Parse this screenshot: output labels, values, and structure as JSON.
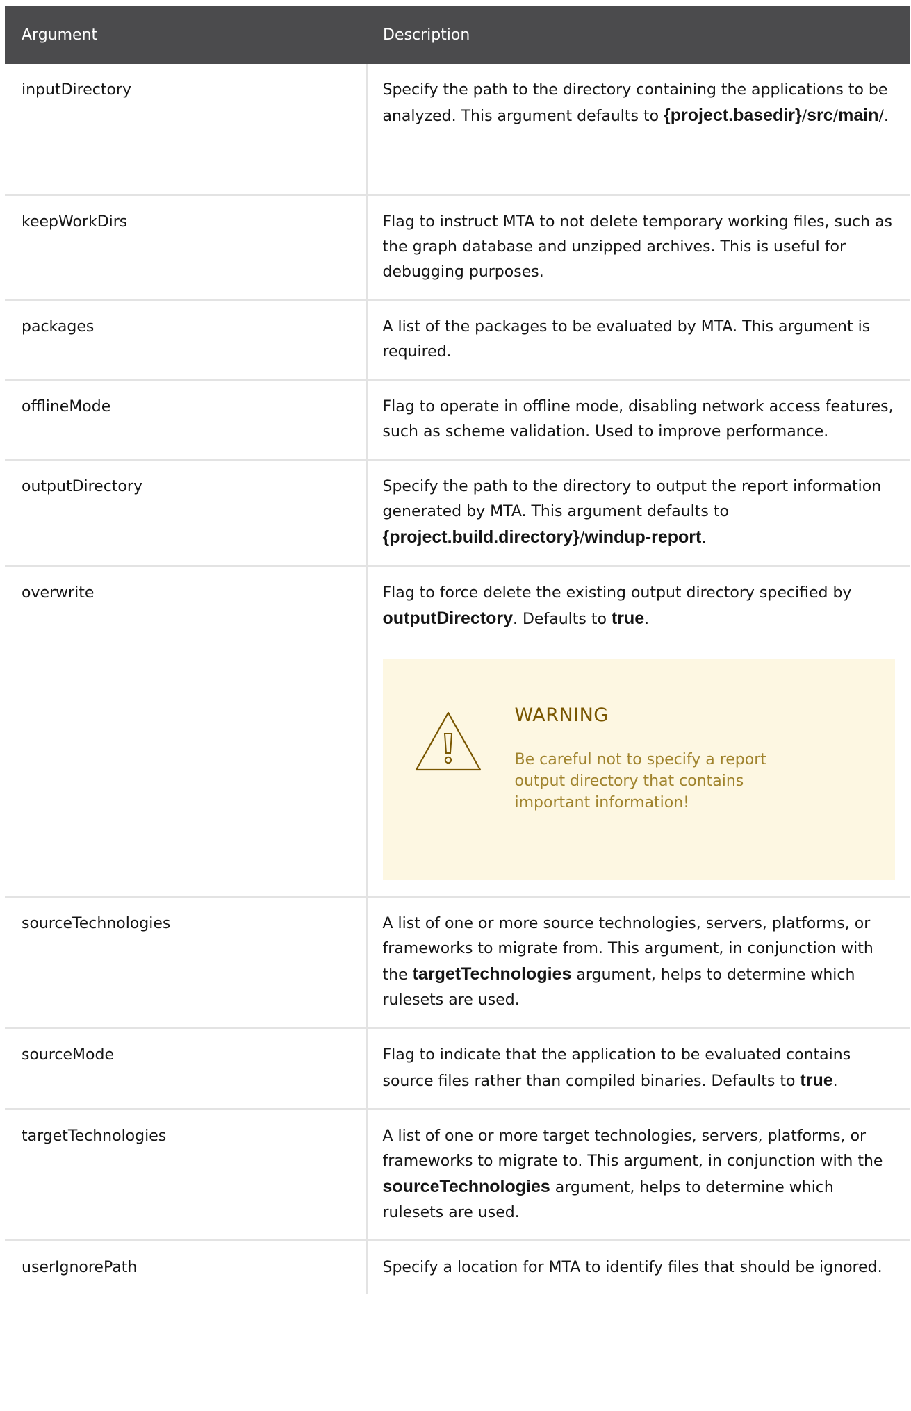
{
  "columns": {
    "argument": "Argument",
    "description": "Description"
  },
  "rows": [
    {
      "arg": "inputDirectory",
      "desc": [
        "Specify the path to the directory containing the applications to be analyzed. This argument defaults to ",
        "{project.basedir}",
        "/",
        "src",
        "/",
        "main",
        "/."
      ]
    },
    {
      "arg": "keepWorkDirs",
      "desc": [
        "Flag to instruct MTA to not delete temporary working files, such as the graph database and unzipped archives. This is useful for debugging purposes."
      ]
    },
    {
      "arg": "packages",
      "desc": [
        "A list of the packages to be evaluated by MTA. This argument is required."
      ]
    },
    {
      "arg": "offlineMode",
      "desc": [
        "Flag to operate in offline mode, disabling network access features, such as scheme validation. Used to improve performance."
      ]
    },
    {
      "arg": "outputDirectory",
      "desc": [
        "Specify the path to the directory to output the report information generated by MTA. This argument defaults to ",
        "{project.build.directory}",
        "/",
        "windup-report",
        "."
      ]
    },
    {
      "arg": "overwrite",
      "desc": [
        "Flag to force delete the existing output directory specified by ",
        "outputDirectory",
        ". Defaults to ",
        "true",
        "."
      ],
      "warning": {
        "title": "WARNING",
        "text": "Be careful not to specify a report output directory that contains important information!",
        "icon": "warning-triangle-icon"
      }
    },
    {
      "arg": "sourceTechnologies",
      "desc": [
        "A list of one or more source technologies, servers, platforms, or frameworks to migrate from. This argument, in conjunction with the ",
        "targetTechnologies",
        " argument, helps to determine which rulesets are used."
      ]
    },
    {
      "arg": "sourceMode",
      "desc": [
        "Flag to indicate that the application to be evaluated contains source files rather than compiled binaries. Defaults to ",
        "true",
        "."
      ]
    },
    {
      "arg": "targetTechnologies",
      "desc": [
        "A list of one or more target technologies, servers, platforms, or frameworks to migrate to. This argument, in conjunction with the ",
        "sourceTechnologies",
        " argument, helps to determine which rulesets are used."
      ]
    },
    {
      "arg": "userIgnorePath",
      "desc": [
        "Specify a location for MTA to identify files that should be ignored."
      ]
    }
  ],
  "colors": {
    "header_bg": "#4b4b4d",
    "warning_bg": "#fdf7e2",
    "warning_title": "#795600",
    "warning_text": "#a0832d"
  }
}
